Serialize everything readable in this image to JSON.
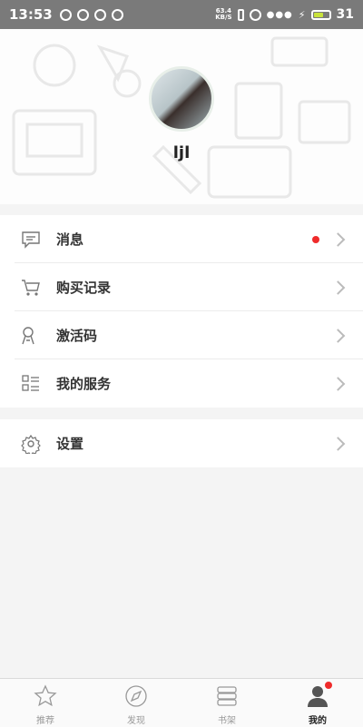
{
  "status_bar": {
    "time": "13:53",
    "net_speed_value": "63.4",
    "net_speed_unit": "KB/S",
    "battery": "31"
  },
  "profile": {
    "username": "ljl"
  },
  "menu": {
    "group1": [
      {
        "label": "消息",
        "icon": "message-icon",
        "badge": true
      },
      {
        "label": "购买记录",
        "icon": "cart-icon",
        "badge": false
      },
      {
        "label": "激活码",
        "icon": "key-icon",
        "badge": false
      },
      {
        "label": "我的服务",
        "icon": "checklist-icon",
        "badge": false
      }
    ],
    "group2": [
      {
        "label": "设置",
        "icon": "gear-icon",
        "badge": false
      }
    ]
  },
  "tabbar": {
    "tabs": [
      {
        "label": "推荐",
        "icon": "star-icon",
        "active": false
      },
      {
        "label": "发现",
        "icon": "compass-icon",
        "active": false
      },
      {
        "label": "书架",
        "icon": "bookshelf-icon",
        "active": false
      },
      {
        "label": "我的",
        "icon": "person-icon",
        "active": true,
        "badge": true
      }
    ]
  },
  "colors": {
    "badge_red": "#ef2b2b",
    "status_bar": "#7a7a7a",
    "background": "#f4f4f4"
  }
}
